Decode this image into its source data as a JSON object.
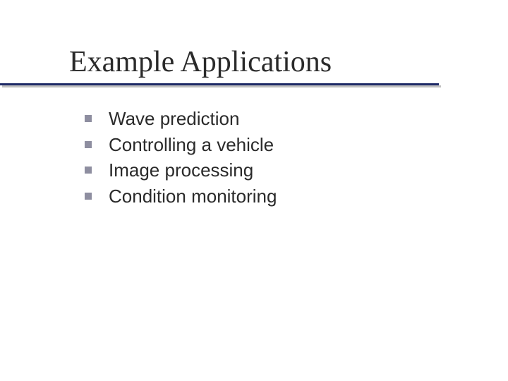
{
  "slide": {
    "title": "Example Applications",
    "bullets": [
      {
        "text": "Wave prediction"
      },
      {
        "text": "Controlling a vehicle"
      },
      {
        "text": "Image processing"
      },
      {
        "text": "Condition monitoring"
      }
    ]
  }
}
